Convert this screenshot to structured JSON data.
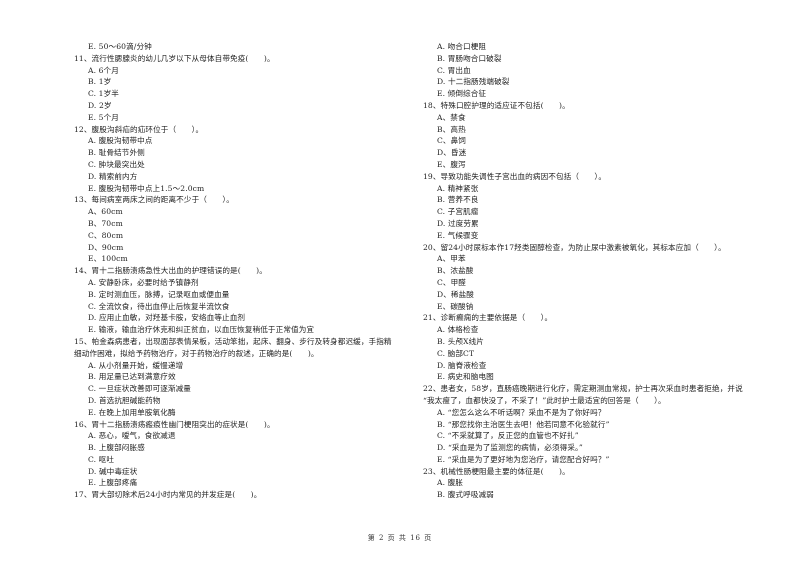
{
  "page": {
    "footer": "第 2 页 共 16 页"
  },
  "left_column": [
    {
      "type": "option",
      "text": "E. 50～60滴/分钟"
    },
    {
      "type": "question",
      "text": "11、流行性腮腺炎的幼儿几岁以下从母体自带免疫(　　)。"
    },
    {
      "type": "option",
      "text": "A. 6个月"
    },
    {
      "type": "option",
      "text": "B. 1岁"
    },
    {
      "type": "option",
      "text": "C. 1岁半"
    },
    {
      "type": "option",
      "text": "D. 2岁"
    },
    {
      "type": "option",
      "text": "E. 5个月"
    },
    {
      "type": "question",
      "text": "12、腹股沟斜疝的疝环位于（　　）。"
    },
    {
      "type": "option",
      "text": "A. 腹股沟韧带中点"
    },
    {
      "type": "option",
      "text": "B. 耻骨结节外侧"
    },
    {
      "type": "option",
      "text": "C. 肿块最突出处"
    },
    {
      "type": "option",
      "text": "D. 精索前内方"
    },
    {
      "type": "option",
      "text": "E. 腹股沟韧带中点上1.5～2.0cm"
    },
    {
      "type": "question",
      "text": "13、每间病室两床之间的距离不少于（　　）。"
    },
    {
      "type": "option",
      "text": "A、60cm"
    },
    {
      "type": "option",
      "text": "B、70cm"
    },
    {
      "type": "option",
      "text": "C、80cm"
    },
    {
      "type": "option",
      "text": "D、90cm"
    },
    {
      "type": "option",
      "text": "E、100cm"
    },
    {
      "type": "question",
      "text": "14、胃十二指肠溃疡急性大出血的护理错误的是(　　)。"
    },
    {
      "type": "option",
      "text": "A. 安静卧床，必要时给予镇静剂"
    },
    {
      "type": "option",
      "text": "B. 定时测血压，脉搏，记录呕血或便血量"
    },
    {
      "type": "option",
      "text": "C. 全流饮食，待出血停止后恢复半流饮食"
    },
    {
      "type": "option",
      "text": "D. 应用止血敏，对羟基卡胺，安络血等止血剂"
    },
    {
      "type": "option",
      "text": "E. 输液，输血治疗休克和纠正贫血，以血压恢复稍低于正常值为宜"
    },
    {
      "type": "question",
      "text": "15、帕金森病患者，出现面部表情呆板，活动笨拙，起床、翻身、步行及转身都迟缓，手指精"
    },
    {
      "type": "question",
      "text": "细动作困难，拟给予药物治疗，对于药物治疗的叙述，正确的是(　　)。"
    },
    {
      "type": "option",
      "text": "A. 从小剂量开始，缓慢递增"
    },
    {
      "type": "option",
      "text": "B. 用足量已达到满意疗效"
    },
    {
      "type": "option",
      "text": "C. 一旦症状改善即可逐渐减量"
    },
    {
      "type": "option",
      "text": "D. 首选抗胆碱能药物"
    },
    {
      "type": "option",
      "text": "E. 在晚上加用单胺氧化酶"
    },
    {
      "type": "question",
      "text": "16、胃十二指肠溃疡瘢痕性幽门梗阻突出的症状是(　　)。"
    },
    {
      "type": "option",
      "text": "A. 恶心，嗳气，食欲减退"
    },
    {
      "type": "option",
      "text": "B. 上腹部闷胀感"
    },
    {
      "type": "option",
      "text": "C. 呕吐"
    },
    {
      "type": "option",
      "text": "D. 碱中毒症状"
    },
    {
      "type": "option",
      "text": "E. 上腹部疼痛"
    },
    {
      "type": "question",
      "text": "17、胃大部切除术后24小时内常见的并发症是(　　)。"
    }
  ],
  "right_column": [
    {
      "type": "option",
      "text": "A. 吻合口梗阻"
    },
    {
      "type": "option",
      "text": "B. 胃肠吻合口破裂"
    },
    {
      "type": "option",
      "text": "C. 胃出血"
    },
    {
      "type": "option",
      "text": "D. 十二指肠残端破裂"
    },
    {
      "type": "option",
      "text": "E. 倾倒综合征"
    },
    {
      "type": "question",
      "text": "18、特殊口腔护理的适应证不包括(　　)。"
    },
    {
      "type": "option",
      "text": "A、禁食"
    },
    {
      "type": "option",
      "text": "B、高热"
    },
    {
      "type": "option",
      "text": "C、鼻饲"
    },
    {
      "type": "option",
      "text": "D、昏迷"
    },
    {
      "type": "option",
      "text": "E、腹泻"
    },
    {
      "type": "question",
      "text": "19、导致功能失调性子宫出血的病因不包括（　　）。"
    },
    {
      "type": "option",
      "text": "A. 精神紧张"
    },
    {
      "type": "option",
      "text": "B. 营养不良"
    },
    {
      "type": "option",
      "text": "C. 子宫肌瘤"
    },
    {
      "type": "option",
      "text": "D. 过度劳累"
    },
    {
      "type": "option",
      "text": "E. 气候骤变"
    },
    {
      "type": "question",
      "text": "20、留24小时尿标本作17羟类固醇检查，为防止尿中激素被氧化，其标本应加（　　）。"
    },
    {
      "type": "option",
      "text": "A、甲苯"
    },
    {
      "type": "option",
      "text": "B、浓盐酸"
    },
    {
      "type": "option",
      "text": "C、甲醛"
    },
    {
      "type": "option",
      "text": "D、稀盐酸"
    },
    {
      "type": "option",
      "text": "E、碳酸钠"
    },
    {
      "type": "question",
      "text": "21、诊断癫痫的主要依据是（　　）。"
    },
    {
      "type": "option",
      "text": "A. 体格检查"
    },
    {
      "type": "option",
      "text": "B. 头颅X线片"
    },
    {
      "type": "option",
      "text": "C. 脑部CT"
    },
    {
      "type": "option",
      "text": "D. 脑脊液检查"
    },
    {
      "type": "option",
      "text": "E. 病史和脑电图"
    },
    {
      "type": "question",
      "text": "22、患者女，58岁，直肠癌晚期进行化疗，需定期测血常规，护士再次采血时患者拒绝，并说"
    },
    {
      "type": "question",
      "text": "“我太瘦了，血都快没了，不采了！”此时护士最适宜的回答是（　　）。"
    },
    {
      "type": "option",
      "text": "A. “您怎么这么不听话啊？采血不是为了你好吗？"
    },
    {
      "type": "option",
      "text": "B. “那您找你主治医生去吧！他若同意不化验就行”"
    },
    {
      "type": "option",
      "text": "C. “不采就算了，反正您的血管也不好扎”"
    },
    {
      "type": "option",
      "text": "D. “采血是为了监测您的病情，必须得采。”"
    },
    {
      "type": "option",
      "text": "E. “采血是为了更好地为您治疗，请您配合好吗？”"
    },
    {
      "type": "question",
      "text": "23、机械性肠梗阻最主要的体征是(　　)。"
    },
    {
      "type": "option",
      "text": "A. 腹胀"
    },
    {
      "type": "option",
      "text": "B. 腹式呼吸减弱"
    }
  ]
}
